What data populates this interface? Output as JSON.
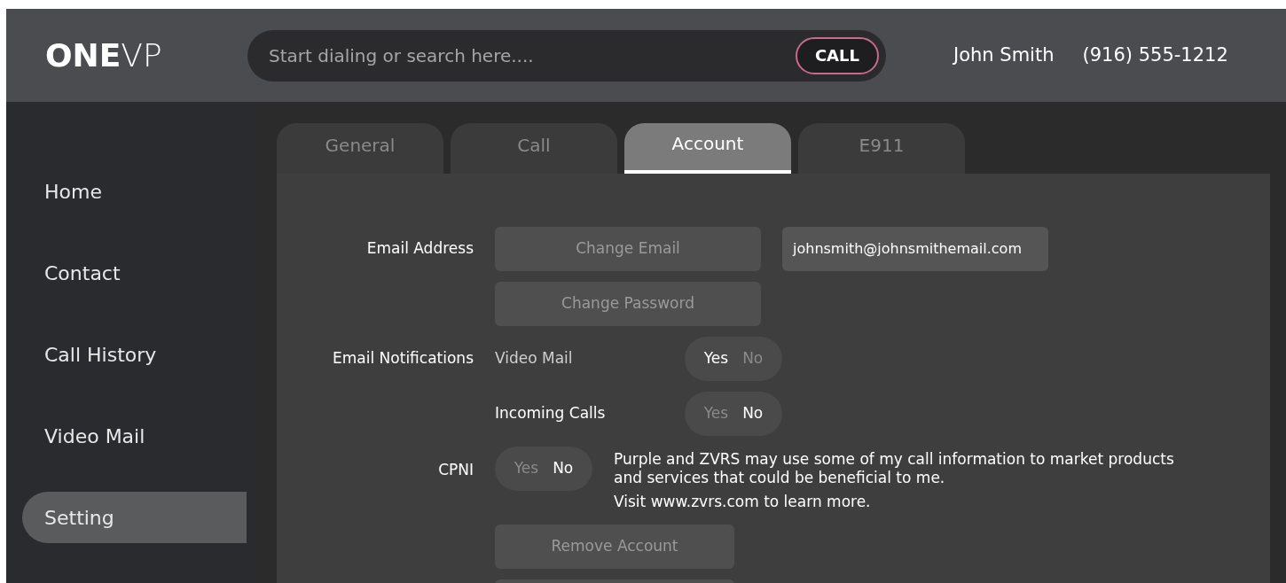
{
  "header": {
    "logo_bold": "ONE",
    "logo_light": "VP",
    "search": {
      "placeholder": "Start dialing or search here...."
    },
    "call_button": "CALL",
    "user_name": "John Smith",
    "phone": "(916) 555-1212"
  },
  "sidebar": {
    "items": [
      {
        "label": "Home",
        "selected": false
      },
      {
        "label": "Contact",
        "selected": false
      },
      {
        "label": "Call History",
        "selected": false
      },
      {
        "label": "Video Mail",
        "selected": false
      },
      {
        "label": "Setting",
        "selected": true
      }
    ]
  },
  "tabs": [
    {
      "label": "General",
      "selected": false
    },
    {
      "label": "Call",
      "selected": false
    },
    {
      "label": "Account",
      "selected": true
    },
    {
      "label": "E911",
      "selected": false
    }
  ],
  "account": {
    "email_label": "Email Address",
    "change_email": "Change Email",
    "email_value": "johnsmith@johnsmithemail.com",
    "change_password": "Change Password",
    "notifications_label": "Email Notifications",
    "notifications": [
      {
        "label": "Video Mail",
        "options": [
          {
            "label": "Yes",
            "selected": true
          },
          {
            "label": "No",
            "selected": false
          }
        ]
      },
      {
        "label": "Incoming Calls",
        "options": [
          {
            "label": "Yes",
            "selected": false
          },
          {
            "label": "No",
            "selected": true
          }
        ]
      }
    ],
    "cpni": {
      "label": "CPNI",
      "options": [
        {
          "label": "Yes",
          "selected": false
        },
        {
          "label": "No",
          "selected": true
        }
      ],
      "text": "Purple and ZVRS may use some of my call information to market products and services that could be beneficial to me.",
      "link_text": "Visit www.zvrs.com to learn more."
    },
    "remove_account": "Remove Account"
  }
}
